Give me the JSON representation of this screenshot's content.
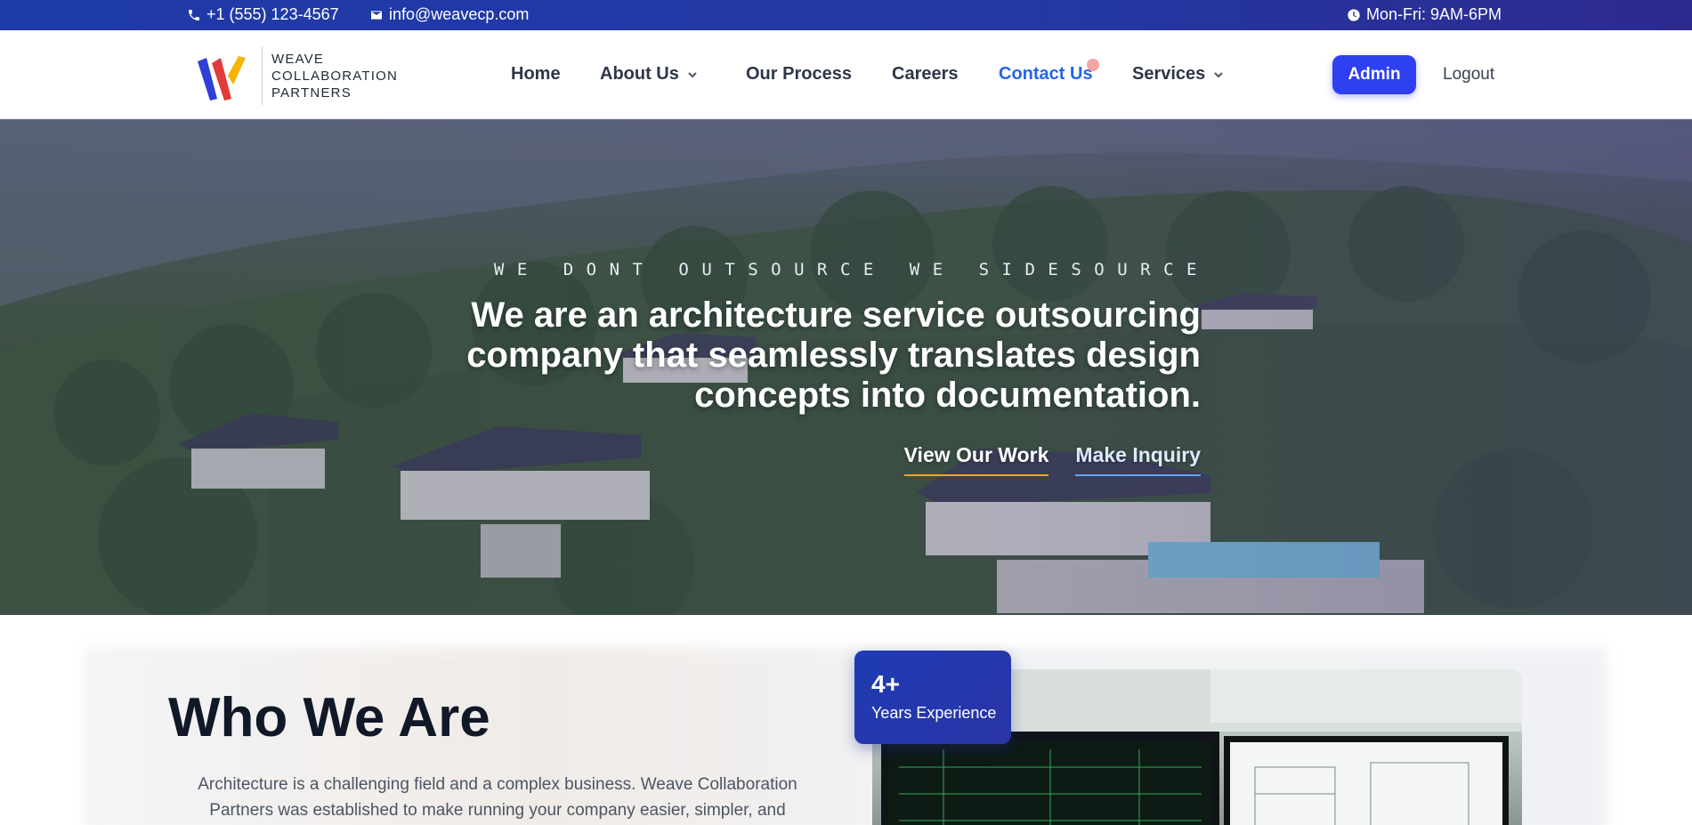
{
  "topbar": {
    "phone": "+1 (555) 123-4567",
    "email": "info@weavecp.com",
    "hours": "Mon-Fri: 9AM-6PM"
  },
  "brand": {
    "line1": "WEAVE",
    "line2": "COLLABORATION",
    "line3": "PARTNERS",
    "colors": [
      "#2d3fd6",
      "#e23b3b",
      "#f5b400"
    ]
  },
  "nav": {
    "items": [
      {
        "label": "Home"
      },
      {
        "label": "About Us"
      },
      {
        "label": "Our Process"
      },
      {
        "label": "Careers"
      },
      {
        "label": "Contact Us"
      },
      {
        "label": "Services"
      }
    ],
    "active": "Contact Us",
    "admin_label": "Admin",
    "logout_label": "Logout"
  },
  "hero": {
    "kicker": "WE DONT OUTSOURCE WE SIDESOURCE",
    "headline_line1": "We are an architecture service outsourcing",
    "headline_line2": "company that seamlessly translates design",
    "headline_line3": "concepts into documentation.",
    "cta_primary": "View Our Work",
    "cta_secondary": "Make Inquiry"
  },
  "who": {
    "title": "Who We Are",
    "body_line1": "Architecture is a challenging field and a complex business. Weave Collaboration",
    "body_line2": "Partners was established to make running your company easier, simpler, and",
    "badge_number": "4+",
    "badge_label": "Years Experience"
  }
}
